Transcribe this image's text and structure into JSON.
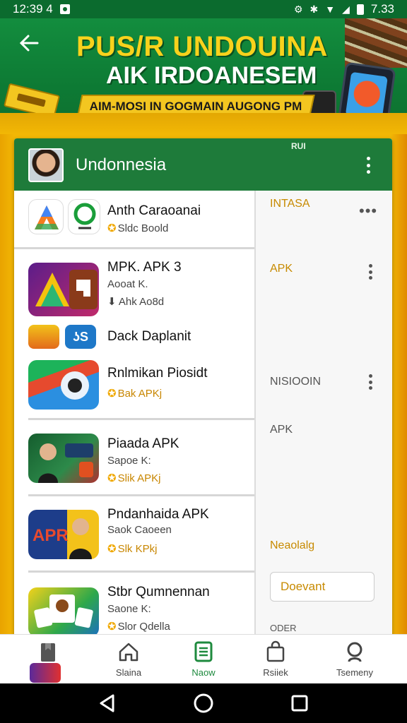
{
  "status_bar": {
    "time_left": "12:39 4",
    "time_right": "7.33"
  },
  "banner": {
    "title": "PUS/R UNDOUINA",
    "subtitle": "AIK IRDOANESEM",
    "ribbon": "AIM-MOSI IN GOGMAIN AUGONG PM"
  },
  "card": {
    "title": "Undonnesia",
    "header_mini": "RUI"
  },
  "apps": [
    {
      "name": "Anth Caraoanai",
      "meta": "",
      "tag": "Sldc Boold"
    },
    {
      "name": "MPK. APK 3",
      "meta": "Aooat K.",
      "tag": "Ahk Ao8d"
    },
    {
      "name": "Dack Daplanit",
      "meta": "",
      "tag": ""
    },
    {
      "name": "Rnlmikan Piosidt",
      "meta": "",
      "tag": "Bak APKj"
    },
    {
      "name": "Piaada APK",
      "meta": "Sapoe K:",
      "tag": "Slik APKj"
    },
    {
      "name": "Pndanhaida APK",
      "meta": "Saok Caoeen",
      "tag": "Slk KPkj"
    },
    {
      "name": "Stbr Qumnennan",
      "meta": "Saone K:",
      "tag": "Slor Qdella"
    }
  ],
  "side": {
    "label1": "INTASA",
    "label2": "APK",
    "label3": "NISIOOIN",
    "label4": "APK",
    "label5": "Neaolalg",
    "input_value": "Doevant",
    "label6": "ODER"
  },
  "nav": [
    {
      "label": "",
      "icon": "bookmark-icon"
    },
    {
      "label": "Slaina",
      "icon": "home-icon"
    },
    {
      "label": "Naow",
      "icon": "document-icon"
    },
    {
      "label": "Rsiiek",
      "icon": "bag-icon"
    },
    {
      "label": "Tsemeny",
      "icon": "search-icon"
    }
  ],
  "colors": {
    "green": "#1e7b3a",
    "yellow": "#f2b705",
    "gold_text": "#c78a00"
  }
}
